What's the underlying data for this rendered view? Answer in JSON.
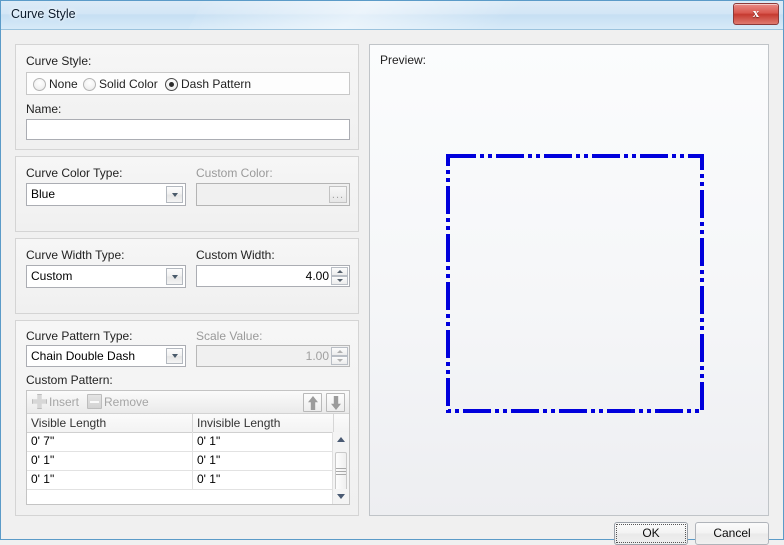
{
  "window": {
    "title": "Curve Style",
    "close_icon": "close-icon",
    "close_label": "x"
  },
  "curve_style_group": {
    "label": "Curve Style:",
    "options": [
      {
        "label": "None",
        "checked": false
      },
      {
        "label": "Solid Color",
        "checked": false
      },
      {
        "label": "Dash Pattern",
        "checked": true
      }
    ],
    "name_label": "Name:",
    "name_value": "",
    "name_placeholder": ""
  },
  "color_group": {
    "type_label": "Curve Color Type:",
    "type_value": "Blue",
    "custom_label": "Custom Color:",
    "custom_value": "",
    "browse_label": "...",
    "disabled": true
  },
  "width_group": {
    "type_label": "Curve Width Type:",
    "type_value": "Custom",
    "custom_label": "Custom Width:",
    "custom_value": "4.00",
    "disabled": false
  },
  "pattern_group": {
    "type_label": "Curve Pattern Type:",
    "type_value": "Chain Double Dash",
    "scale_label": "Scale Value:",
    "scale_value": "1.00",
    "scale_disabled": true,
    "custom_pattern_label": "Custom Pattern:",
    "toolbar": {
      "insert_label": "Insert",
      "insert_icon": "plus-icon",
      "insert_disabled": true,
      "remove_label": "Remove",
      "remove_icon": "minus-icon",
      "remove_disabled": true,
      "move_up_icon": "arrow-up-icon",
      "move_down_icon": "arrow-down-icon"
    },
    "table": {
      "columns": [
        "Visible Length",
        "Invisible Length"
      ],
      "rows": [
        [
          "0' 7\"",
          "0' 1\""
        ],
        [
          "0' 1\"",
          "0' 1\""
        ],
        [
          "0' 1\"",
          "0' 1\""
        ]
      ]
    }
  },
  "preview": {
    "label": "Preview:",
    "stroke_color": "#0000DC",
    "stroke_width": 4,
    "dash_array": "28 4 4 4 4 4",
    "shape": "rectangle"
  },
  "buttons": {
    "ok_label": "OK",
    "cancel_label": "Cancel"
  }
}
